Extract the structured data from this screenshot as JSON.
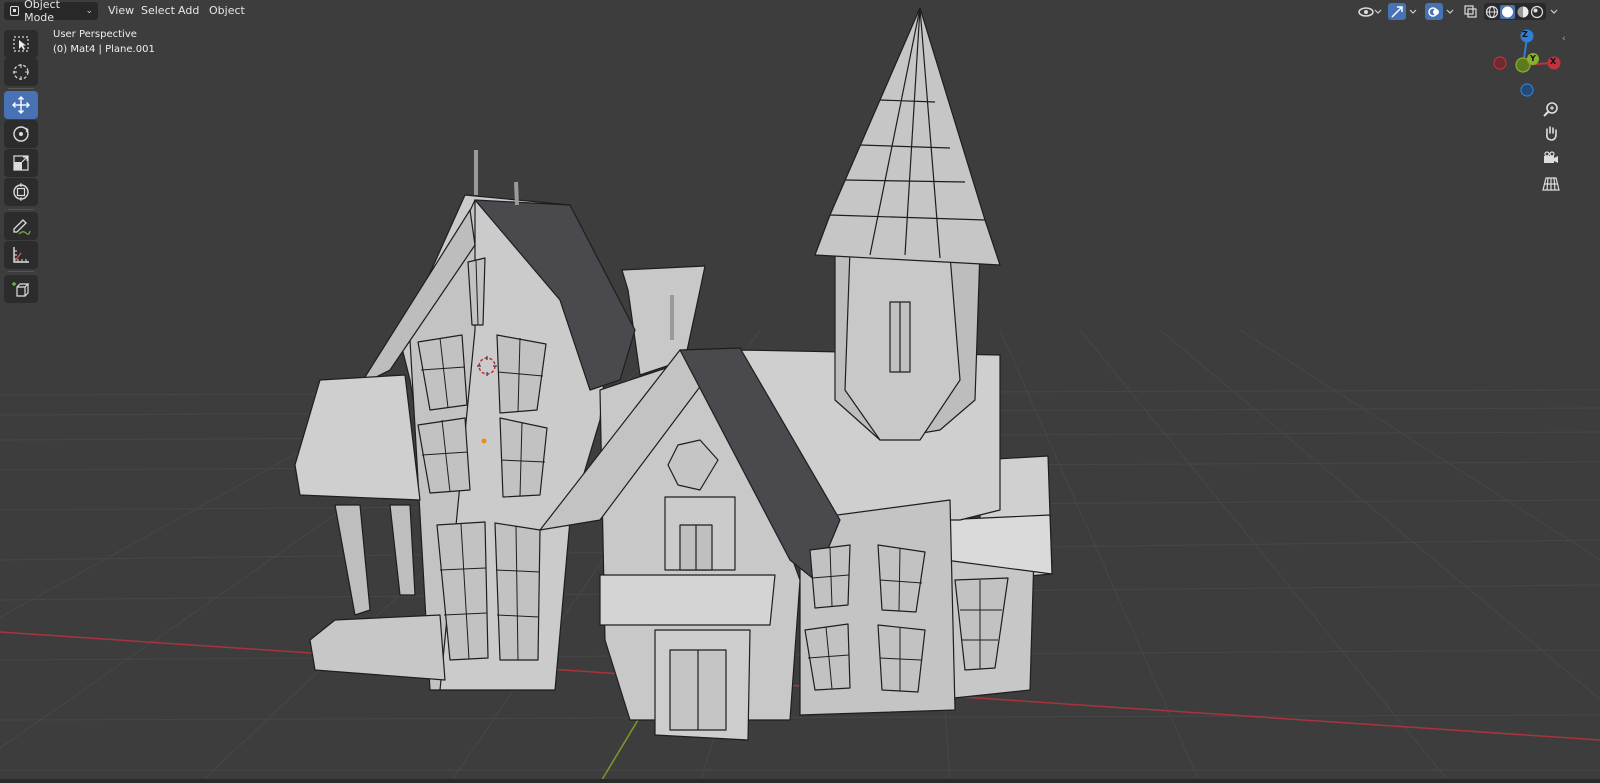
{
  "header": {
    "mode_label": "Object Mode",
    "menus": [
      "View",
      "Select",
      "Add",
      "Object"
    ]
  },
  "viewport": {
    "view_name": "User Perspective",
    "object_info": "(0) Mat4 | Plane.001"
  },
  "toolbar": {
    "tools": [
      "select-box",
      "cursor",
      "move",
      "rotate",
      "scale",
      "transform",
      "annotate",
      "measure",
      "add-cube"
    ],
    "active_tool": "move"
  },
  "gizmo": {
    "x_label": "X",
    "y_label": "Y",
    "z_label": "Z"
  },
  "colors": {
    "background": "#3d3d3d",
    "grid": "#464646",
    "x_axis": "#c0333c",
    "y_axis": "#8ab12b",
    "z_axis": "#2f7fd6",
    "accent": "#4772b3",
    "wall": "#c9c9c9",
    "roof": "#4a494d"
  }
}
